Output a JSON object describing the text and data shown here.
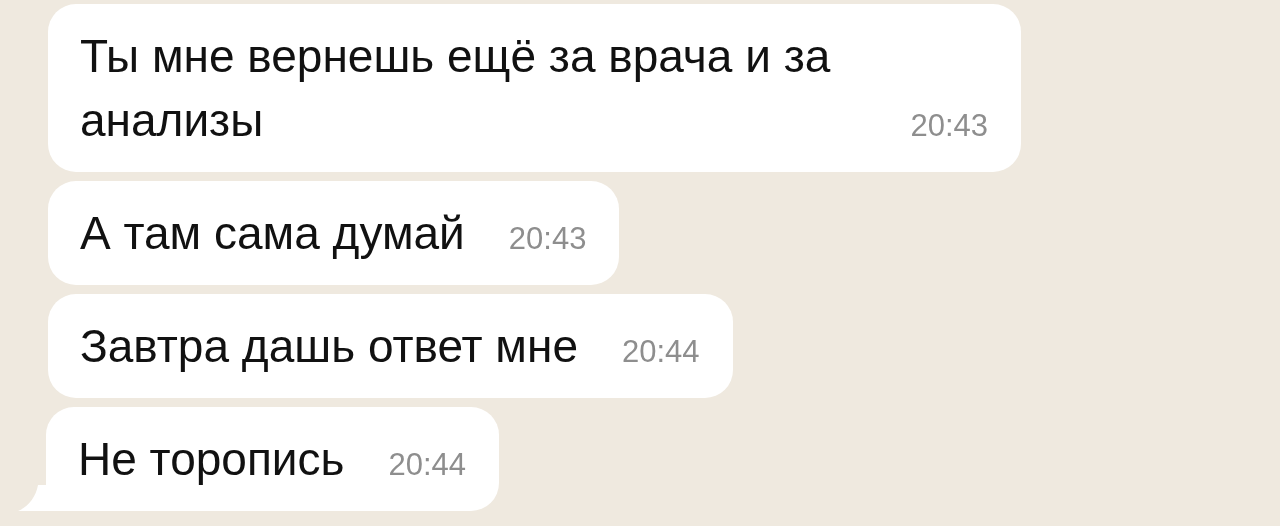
{
  "messages": [
    {
      "text": "Ты мне вернешь ещё за врача и за анализы",
      "time": "20:43",
      "tail": false
    },
    {
      "text": "А там сама думай",
      "time": "20:43",
      "tail": false
    },
    {
      "text": "Завтра дашь ответ мне",
      "time": "20:44",
      "tail": false
    },
    {
      "text": "Не торопись",
      "time": "20:44",
      "tail": true
    }
  ]
}
